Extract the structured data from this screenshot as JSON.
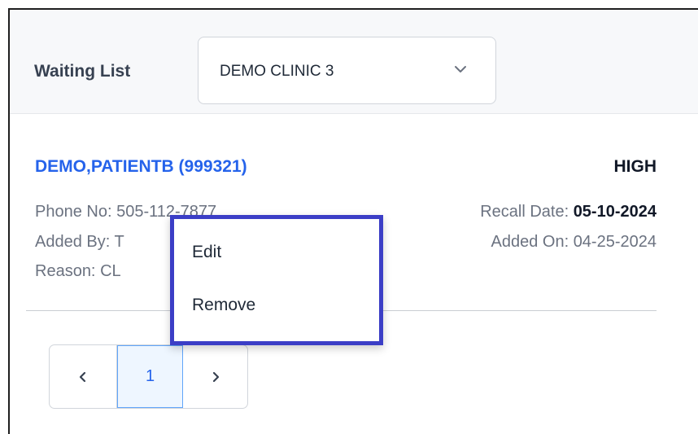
{
  "header": {
    "title": "Waiting List",
    "clinic_select": {
      "value": "DEMO CLINIC 3"
    }
  },
  "patient": {
    "name": "DEMO,PATIENTB (999321)",
    "priority": "HIGH",
    "phone_label": "Phone No:",
    "phone_visible": "505-112-7877",
    "recall_label": "Recall Date:",
    "recall_date": "05-10-2024",
    "added_by_label": "Added By:",
    "added_by_visible": "T",
    "added_on_label": "Added On:",
    "added_on_value": "04-25-2024",
    "reason_label": "Reason:",
    "reason_visible": "CL"
  },
  "pagination": {
    "current_page": "1"
  },
  "context_menu": {
    "items": [
      "Edit",
      "Remove"
    ]
  },
  "colors": {
    "accent": "#2563eb",
    "menu_border": "#3b3ec6"
  }
}
